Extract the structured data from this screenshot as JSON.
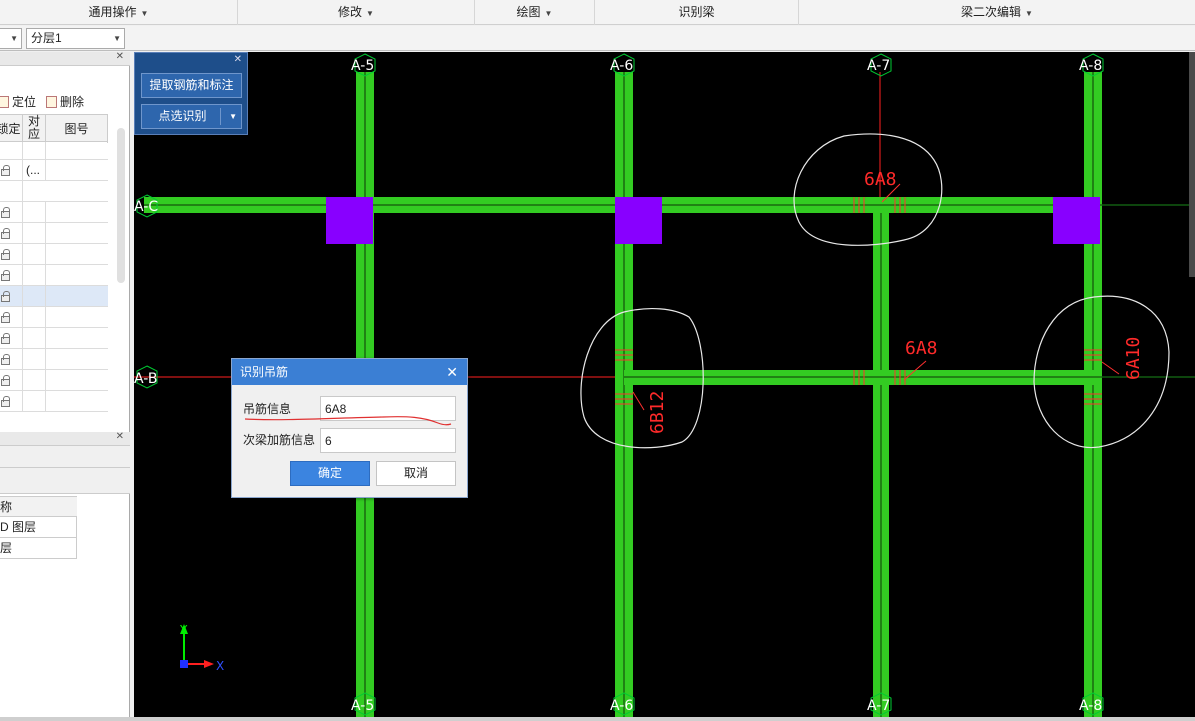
{
  "menubar": {
    "items": [
      {
        "label": "通用操作",
        "has_caret": true
      },
      {
        "label": "修改",
        "has_caret": true
      },
      {
        "label": "绘图",
        "has_caret": true
      },
      {
        "label": "识别梁",
        "has_caret": false
      },
      {
        "label": "梁二次编辑",
        "has_caret": true
      }
    ]
  },
  "toolbar": {
    "layer_combo": "分层1"
  },
  "left_panel": {
    "locate_label": "定位",
    "delete_label": "删除",
    "columns": [
      "锁定",
      "对应",
      "图号"
    ],
    "first_row_value": "(...",
    "bottom_header": "称",
    "bottom_rows": [
      "D 图层",
      "层"
    ]
  },
  "float_panel": {
    "extract_button": "提取钢筋和标注",
    "point_select_button": "点选识别"
  },
  "dialog": {
    "title": "识别吊筋",
    "hanger_label": "吊筋信息",
    "hanger_value": "6A8",
    "secondary_label": "次梁加筋信息",
    "secondary_value": "6",
    "ok_label": "确定",
    "cancel_label": "取消"
  },
  "cad": {
    "axes": {
      "top": [
        "A-5",
        "A-6",
        "A-7",
        "A-8"
      ],
      "bottom": [
        "A-5",
        "A-6",
        "A-7",
        "A-8"
      ],
      "left": [
        "A-C",
        "A-B"
      ]
    },
    "annotations": [
      "6A8",
      "6A8",
      "6B12",
      "6A10"
    ],
    "ucs": {
      "x": "X",
      "y": "Y"
    },
    "colors": {
      "beam": "#33cc22",
      "column": "#8800ff",
      "axis_line": "#ff2020",
      "annotation": "#ff2a2a",
      "bubble": "#00cc33"
    }
  }
}
